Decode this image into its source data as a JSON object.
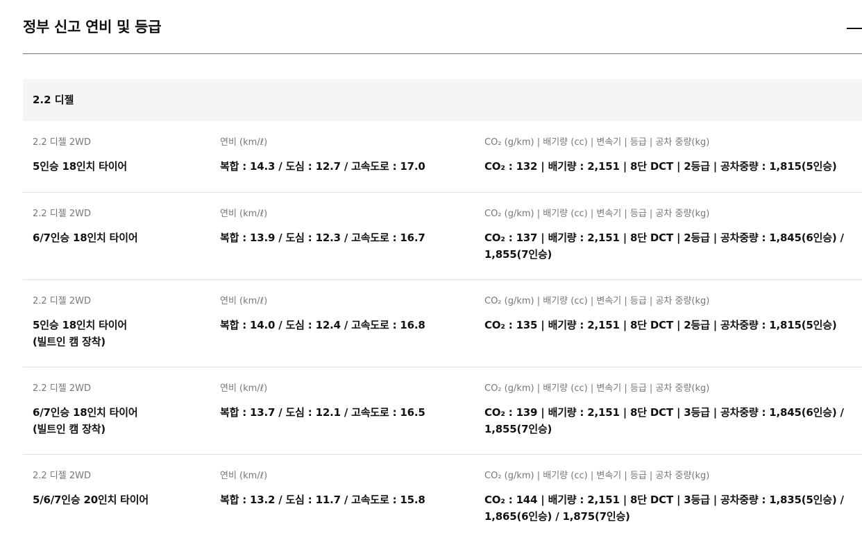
{
  "accordion": {
    "title": "정부 신고 연비 및 등급",
    "collapse_icon": "minus-icon"
  },
  "section": {
    "title": "2.2 디젤"
  },
  "rows": [
    {
      "trim_label": "2.2 디젤 2WD",
      "trim_value": "5인승 18인치 타이어",
      "fuel_label": "연비 (km/ℓ)",
      "fuel_value": "복합 : 14.3 / 도심 : 12.7 / 고속도로 : 17.0",
      "spec_label": "CO₂ (g/km) | 배기량 (cc) | 변속기 | 등급 | 공차 중량(kg)",
      "spec_value": "CO₂ : 132 | 배기량 : 2,151 | 8단 DCT | 2등급 | 공차중량 : 1,815(5인승)"
    },
    {
      "trim_label": "2.2 디젤 2WD",
      "trim_value": "6/7인승 18인치 타이어",
      "fuel_label": "연비 (km/ℓ)",
      "fuel_value": "복합 : 13.9 / 도심 : 12.3 / 고속도로 : 16.7",
      "spec_label": "CO₂ (g/km) | 배기량 (cc) | 변속기 | 등급 | 공차 중량(kg)",
      "spec_value": "CO₂ : 137 | 배기량 : 2,151 | 8단 DCT | 2등급 | 공차중량 : 1,845(6인승) / 1,855(7인승)"
    },
    {
      "trim_label": "2.2 디젤 2WD",
      "trim_value": "5인승 18인치 타이어\n(빌트인 캠 장착)",
      "fuel_label": "연비 (km/ℓ)",
      "fuel_value": "복합 : 14.0 / 도심 : 12.4 / 고속도로 : 16.8",
      "spec_label": "CO₂ (g/km) | 배기량 (cc) | 변속기 | 등급 | 공차 중량(kg)",
      "spec_value": "CO₂ : 135 | 배기량 : 2,151 | 8단 DCT | 2등급 | 공차중량 : 1,815(5인승)"
    },
    {
      "trim_label": "2.2 디젤 2WD",
      "trim_value": "6/7인승 18인치 타이어\n(빌트인 캠 장착)",
      "fuel_label": "연비 (km/ℓ)",
      "fuel_value": "복합 : 13.7 / 도심 : 12.1 / 고속도로 : 16.5",
      "spec_label": "CO₂ (g/km) | 배기량 (cc) | 변속기 | 등급 | 공차 중량(kg)",
      "spec_value": "CO₂ : 139 | 배기량 : 2,151 | 8단 DCT | 3등급 | 공차중량 : 1,845(6인승) / 1,855(7인승)"
    },
    {
      "trim_label": "2.2 디젤 2WD",
      "trim_value": "5/6/7인승 20인치 타이어",
      "fuel_label": "연비 (km/ℓ)",
      "fuel_value": "복합 : 13.2 / 도심 : 11.7 / 고속도로 : 15.8",
      "spec_label": "CO₂ (g/km) | 배기량 (cc) | 변속기 | 등급 | 공차 중량(kg)",
      "spec_value": "CO₂ : 144 | 배기량 : 2,151 | 8단 DCT | 3등급 | 공차중량 : 1,835(5인승) / 1,865(6인승) / 1,875(7인승)"
    }
  ]
}
